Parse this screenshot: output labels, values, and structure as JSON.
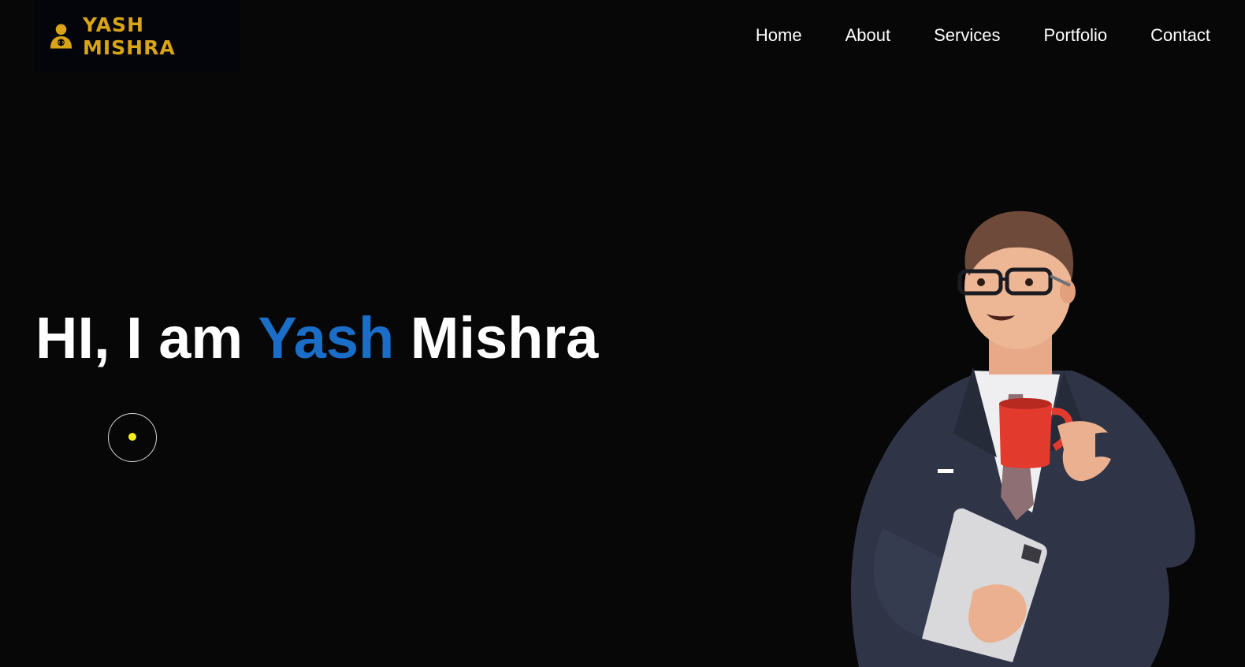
{
  "logo": {
    "text": "YASH MISHRA",
    "icon": "developer-person-icon",
    "color": "#d9a516"
  },
  "nav": {
    "items": [
      {
        "label": "Home"
      },
      {
        "label": "About"
      },
      {
        "label": "Services"
      },
      {
        "label": "Portfolio"
      },
      {
        "label": "Contact"
      }
    ]
  },
  "hero": {
    "greeting": "HI, I am",
    "first_name": "Yash",
    "last_name": "Mishra",
    "accent_color": "#1a6ec7"
  },
  "cursor": {
    "dot_color": "#f3ef14"
  },
  "illustration": {
    "icon": "businessman-with-coffee-mug-illustration"
  },
  "theme": {
    "background": "#070707",
    "text": "#ffffff"
  }
}
